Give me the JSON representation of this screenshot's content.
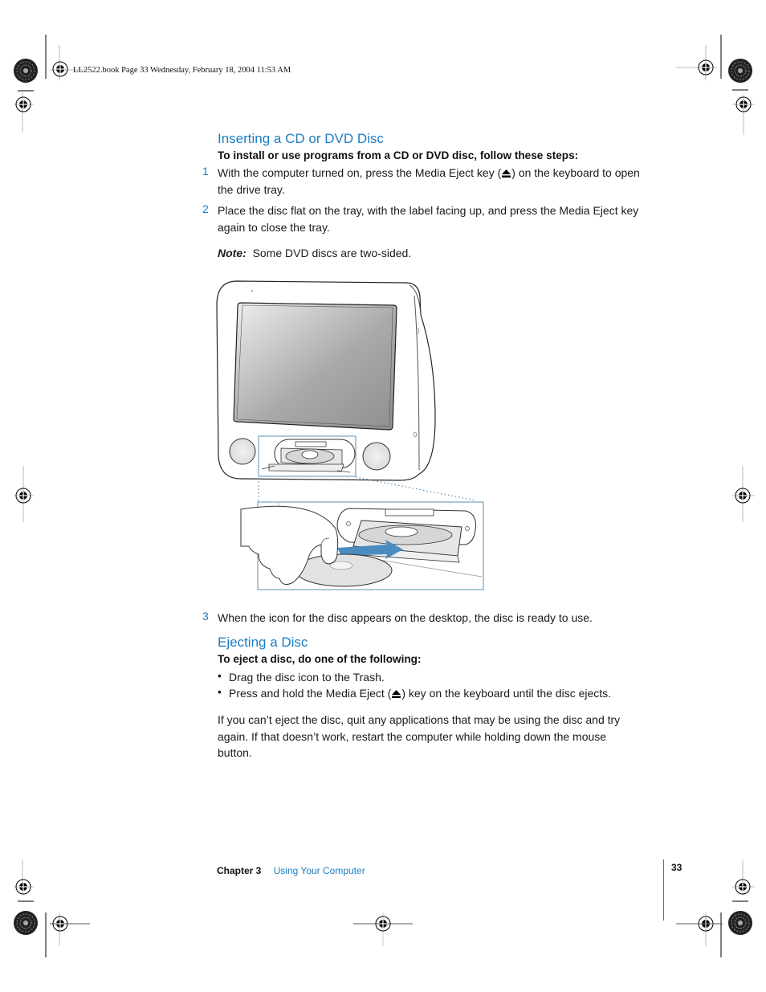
{
  "slug": {
    "text": "LL2522.book  Page 33  Wednesday, February 18, 2004  11:53 AM"
  },
  "colors": {
    "accent": "#1d7ec2",
    "text": "#1a1a1a"
  },
  "section1": {
    "heading": "Inserting a CD or DVD Disc",
    "lead": "To install or use programs from a CD or DVD disc, follow these steps:",
    "steps": [
      {
        "number": "1",
        "line1_before": "With the computer turned on, press the Media Eject key (",
        "line1_after": ") on the keyboard to open",
        "line2": "the drive tray."
      },
      {
        "number": "2",
        "line1": "Place the disc flat on the tray, with the label facing up, and press the Media Eject key",
        "line2": "again to close the tray."
      }
    ],
    "note_label": "Note:",
    "note_text": "Some DVD discs are two-sided.",
    "step3": {
      "number": "3",
      "text": "When the icon for the disc appears on the desktop, the disc is ready to use."
    }
  },
  "illustration": {
    "icon": "emac-disc-tray-illustration",
    "description": "eMac computer with open optical drive tray; inset shows hand placing disc onto tray"
  },
  "section2": {
    "heading": "Ejecting a Disc",
    "lead": "To eject a disc, do one of the following:",
    "bullets": [
      {
        "text": "Drag the disc icon to the Trash."
      },
      {
        "before": "Press and hold the Media Eject (",
        "after": ") key on the keyboard until the disc ejects."
      }
    ],
    "paragraph": [
      "If you can’t eject the disc, quit any applications that may be using the disc and try",
      "again. If that doesn’t work, restart the computer while holding down the mouse",
      "button."
    ]
  },
  "footer": {
    "chapter": "Chapter 3",
    "title": "Using Your Computer",
    "page": "33"
  },
  "printer_marks": {
    "icons": [
      "registration-mark-icon",
      "color-bar-icon",
      "crop-mark-icon"
    ]
  }
}
